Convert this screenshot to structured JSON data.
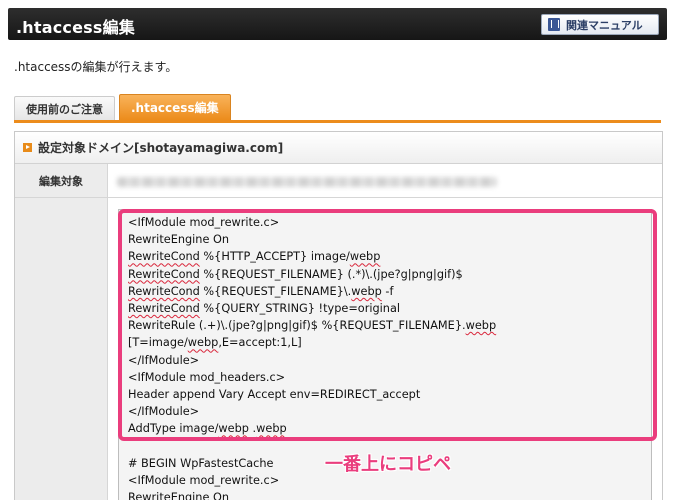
{
  "header": {
    "title": ".htaccess編集",
    "manual_button": "関連マニュアル"
  },
  "description": ".htaccessの編集が行えます。",
  "tabs": [
    {
      "label": "使用前のご注意",
      "active": false
    },
    {
      "label": ".htaccess編集",
      "active": true
    }
  ],
  "panel": {
    "header": "設定対象ドメイン[shotayamagiwa.com]",
    "target_label": "編集対象",
    "textarea": {
      "lines": [
        "<IfModule mod_rewrite.c>",
        "RewriteEngine On",
        "RewriteCond %{HTTP_ACCEPT} image/webp",
        "RewriteCond %{REQUEST_FILENAME} (.*)\\.(jpe?g|png|gif)$",
        "RewriteCond %{REQUEST_FILENAME}\\.webp -f",
        "RewriteCond %{QUERY_STRING} !type=original",
        "RewriteRule (.+)\\.(jpe?g|png|gif)$ %{REQUEST_FILENAME}.webp [T=image/webp,E=accept:1,L]",
        "</IfModule>",
        "<IfModule mod_headers.c>",
        "Header append Vary Accept env=REDIRECT_accept",
        "</IfModule>",
        "AddType image/webp .webp",
        "",
        "# BEGIN WpFastestCache",
        "<IfModule mod_rewrite.c>",
        "RewriteEngine On"
      ]
    }
  },
  "annotation": "一番上にコピペ",
  "colors": {
    "accent_orange": "#ec8c1c",
    "highlight_pink": "#ea3d7d",
    "titlebar": "#1e1e1e"
  }
}
